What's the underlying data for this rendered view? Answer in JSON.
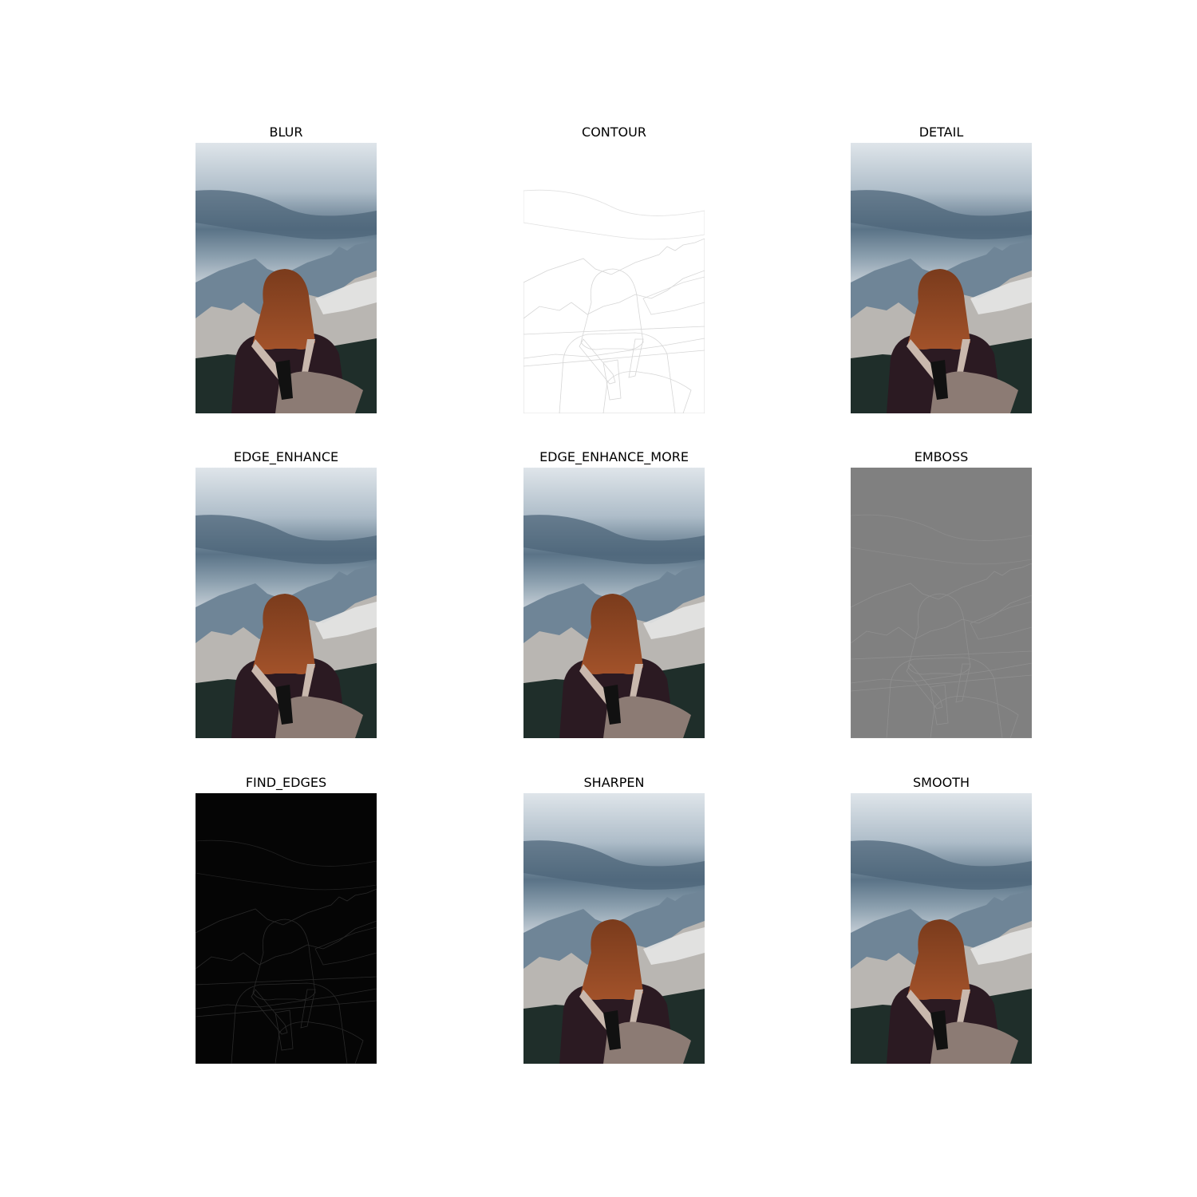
{
  "panels": [
    {
      "title": "BLUR",
      "filter": "normal"
    },
    {
      "title": "CONTOUR",
      "filter": "contour"
    },
    {
      "title": "DETAIL",
      "filter": "normal"
    },
    {
      "title": "EDGE_ENHANCE",
      "filter": "normal"
    },
    {
      "title": "EDGE_ENHANCE_MORE",
      "filter": "normal"
    },
    {
      "title": "EMBOSS",
      "filter": "emboss"
    },
    {
      "title": "FIND_EDGES",
      "filter": "edges"
    },
    {
      "title": "SHARPEN",
      "filter": "normal"
    },
    {
      "title": "SMOOTH",
      "filter": "normal"
    }
  ]
}
